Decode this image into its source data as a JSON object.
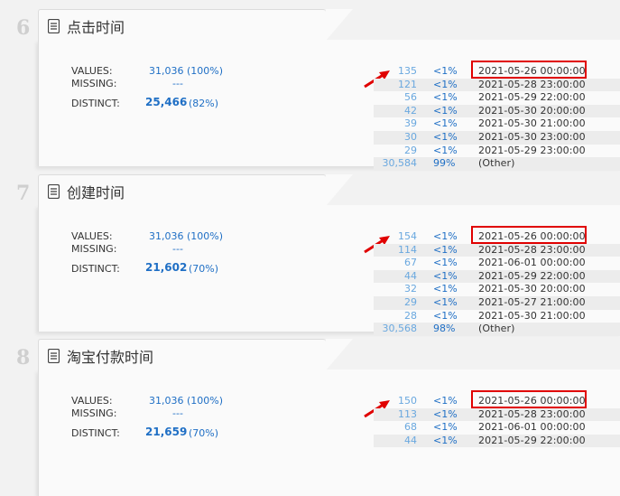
{
  "panels": [
    {
      "number": "6",
      "title": "点击时间",
      "values_label": "VALUES:",
      "values": "31,036 (100%)",
      "missing_label": "MISSING:",
      "missing": "---",
      "distinct_label": "DISTINCT:",
      "distinct_count": "25,466",
      "distinct_pct": "(82%)",
      "frequencies": [
        {
          "count": "135",
          "pct": "<1%",
          "value": "2021-05-26 00:00:00"
        },
        {
          "count": "121",
          "pct": "<1%",
          "value": "2021-05-28 23:00:00"
        },
        {
          "count": "56",
          "pct": "<1%",
          "value": "2021-05-29 22:00:00"
        },
        {
          "count": "42",
          "pct": "<1%",
          "value": "2021-05-30 20:00:00"
        },
        {
          "count": "39",
          "pct": "<1%",
          "value": "2021-05-30 21:00:00"
        },
        {
          "count": "30",
          "pct": "<1%",
          "value": "2021-05-30 23:00:00"
        },
        {
          "count": "29",
          "pct": "<1%",
          "value": "2021-05-29 23:00:00"
        },
        {
          "count": "30,584",
          "pct": "99%",
          "value": "(Other)"
        }
      ]
    },
    {
      "number": "7",
      "title": "创建时间",
      "values_label": "VALUES:",
      "values": "31,036 (100%)",
      "missing_label": "MISSING:",
      "missing": "---",
      "distinct_label": "DISTINCT:",
      "distinct_count": "21,602",
      "distinct_pct": "(70%)",
      "frequencies": [
        {
          "count": "154",
          "pct": "<1%",
          "value": "2021-05-26 00:00:00"
        },
        {
          "count": "114",
          "pct": "<1%",
          "value": "2021-05-28 23:00:00"
        },
        {
          "count": "67",
          "pct": "<1%",
          "value": "2021-06-01 00:00:00"
        },
        {
          "count": "44",
          "pct": "<1%",
          "value": "2021-05-29 22:00:00"
        },
        {
          "count": "32",
          "pct": "<1%",
          "value": "2021-05-30 20:00:00"
        },
        {
          "count": "29",
          "pct": "<1%",
          "value": "2021-05-27 21:00:00"
        },
        {
          "count": "28",
          "pct": "<1%",
          "value": "2021-05-30 21:00:00"
        },
        {
          "count": "30,568",
          "pct": "98%",
          "value": "(Other)"
        }
      ]
    },
    {
      "number": "8",
      "title": "淘宝付款时间",
      "values_label": "VALUES:",
      "values": "31,036 (100%)",
      "missing_label": "MISSING:",
      "missing": "---",
      "distinct_label": "DISTINCT:",
      "distinct_count": "21,659",
      "distinct_pct": "(70%)",
      "frequencies": [
        {
          "count": "150",
          "pct": "<1%",
          "value": "2021-05-26 00:00:00"
        },
        {
          "count": "113",
          "pct": "<1%",
          "value": "2021-05-28 23:00:00"
        },
        {
          "count": "68",
          "pct": "<1%",
          "value": "2021-06-01 00:00:00"
        },
        {
          "count": "44",
          "pct": "<1%",
          "value": "2021-05-29 22:00:00"
        }
      ]
    }
  ],
  "annotation": {
    "highlight_color": "#e00000",
    "arrow_icon": "red-arrow-icon"
  },
  "colors": {
    "accent": "#1f6fc5",
    "count_light": "#6aa8df"
  }
}
